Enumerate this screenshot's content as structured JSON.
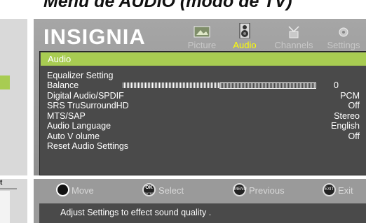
{
  "heading": "Menu de AUDIO (modo de TV)",
  "left_panel": {
    "label": "t"
  },
  "brand": "INSIGNIA",
  "tabs": [
    {
      "label": "Picture",
      "icon": "picture-icon",
      "active": false
    },
    {
      "label": "Audio",
      "icon": "speaker-icon",
      "active": true
    },
    {
      "label": "Channels",
      "icon": "antenna-icon",
      "active": false
    },
    {
      "label": "Settings",
      "icon": "settings-icon",
      "active": false
    }
  ],
  "menu": {
    "title": "Audio",
    "items": [
      {
        "label": "Equalizer Setting",
        "value": ""
      },
      {
        "label": "Balance",
        "value": "0",
        "slider": 0.5
      },
      {
        "label": "Digital  Audio/SPDIF",
        "value": "PCM"
      },
      {
        "label": "SRS TruSurroundHD",
        "value": "Off"
      },
      {
        "label": "MTS/SAP",
        "value": "Stereo"
      },
      {
        "label": "Audio Language",
        "value": "English"
      },
      {
        "label": "Auto  V olume",
        "value": "Off"
      },
      {
        "label": "Reset Audio Settings",
        "value": ""
      }
    ]
  },
  "footer": {
    "move": "Move",
    "ok_top": "OK",
    "ok_bottom": "ENTER",
    "select": "Select",
    "menu_btn": "MENU",
    "previous": "Previous",
    "exit_btn": "EXIT",
    "exit": "Exit",
    "help_text": "Adjust Settings to effect sound quality      ."
  },
  "colors": {
    "accent": "#a8cc52",
    "panel": "#9a9a9a",
    "menu_bg": "#4a4a4a",
    "active_tab": "#ffff00"
  }
}
